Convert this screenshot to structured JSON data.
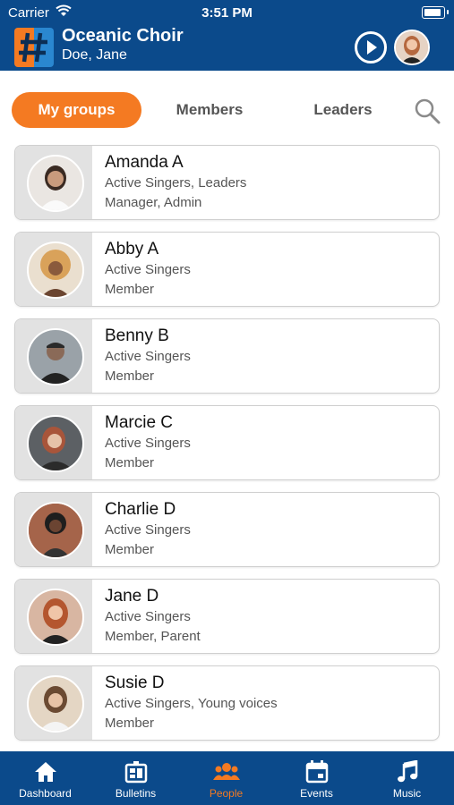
{
  "status_bar": {
    "carrier": "Carrier",
    "time": "3:51 PM"
  },
  "header": {
    "org_name": "Oceanic Choir",
    "user_name": "Doe, Jane",
    "logo_icon": "hashtag-logo",
    "play_icon": "play-circle-icon"
  },
  "tabs": {
    "my_groups": "My groups",
    "members": "Members",
    "leaders": "Leaders",
    "active": "my_groups"
  },
  "people": [
    {
      "name": "Amanda A",
      "groups": "Active Singers, Leaders",
      "roles": "Manager, Admin",
      "avatar_color": "#e9e4df"
    },
    {
      "name": "Abby A",
      "groups": "Active Singers",
      "roles": "Member",
      "avatar_color": "#d9a25a"
    },
    {
      "name": "Benny B",
      "groups": "Active Singers",
      "roles": "Member",
      "avatar_color": "#6a6f74"
    },
    {
      "name": "Marcie C",
      "groups": "Active Singers",
      "roles": "Member",
      "avatar_color": "#5a5a5c"
    },
    {
      "name": "Charlie D",
      "groups": "Active Singers",
      "roles": "Member",
      "avatar_color": "#8d5a44"
    },
    {
      "name": "Jane D",
      "groups": "Active Singers",
      "roles": "Member, Parent",
      "avatar_color": "#c98a72"
    },
    {
      "name": "Susie D",
      "groups": "Active Singers, Young voices",
      "roles": "Member",
      "avatar_color": "#cfb79c"
    }
  ],
  "tabbar": {
    "items": [
      {
        "label": "Dashboard",
        "icon": "home-icon"
      },
      {
        "label": "Bulletins",
        "icon": "bulletin-board-icon"
      },
      {
        "label": "People",
        "icon": "people-icon"
      },
      {
        "label": "Events",
        "icon": "calendar-icon"
      },
      {
        "label": "Music",
        "icon": "music-note-icon"
      }
    ],
    "active": "People"
  },
  "colors": {
    "brand_blue": "#0b4a8b",
    "accent_orange": "#f47a22"
  }
}
